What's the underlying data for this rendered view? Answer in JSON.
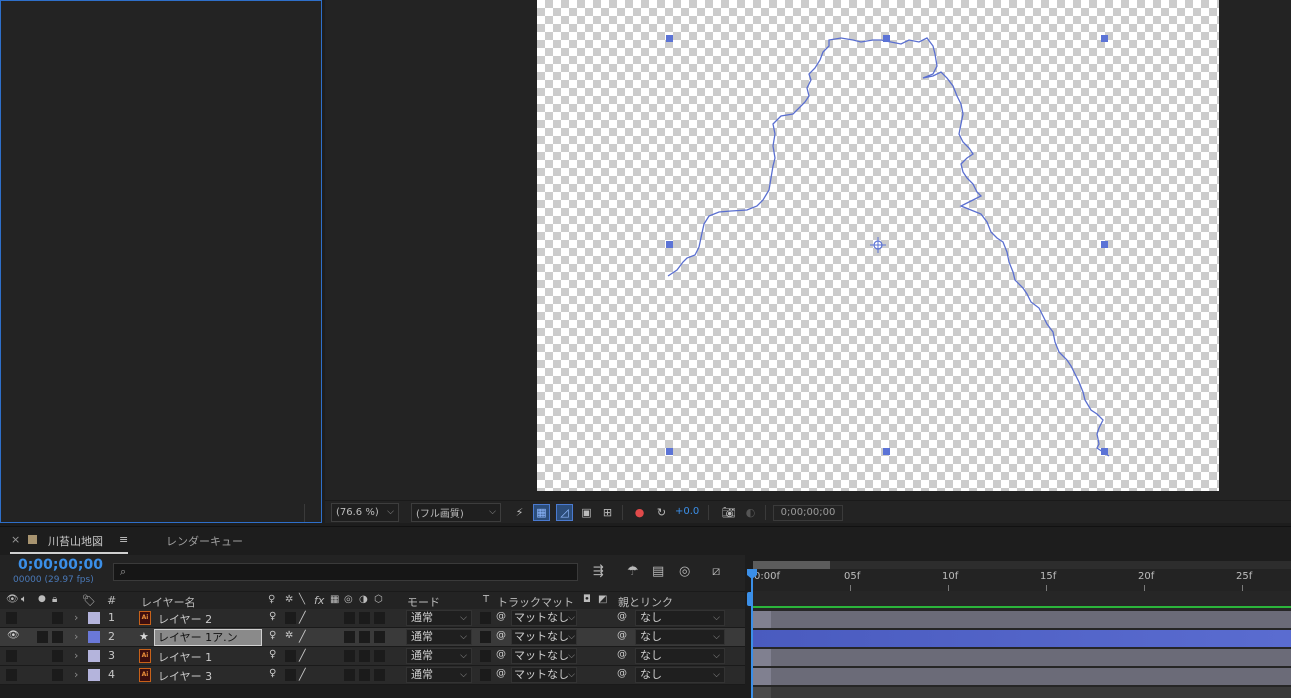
{
  "viewer": {
    "zoom": "(76.6 %)",
    "resolution": "(フル画質)",
    "exposure": "+0.0",
    "timecode": "0;00;00;00"
  },
  "timeline": {
    "tab_close": "×",
    "comp_tab": "川苔山地図",
    "comp_menu": "≡",
    "render_queue_tab": "レンダーキュー",
    "current_time": "0;00;00;00",
    "frame_info": "00000 (29.97 fps)",
    "search_placeholder": "",
    "columns": {
      "number": "#",
      "layer_name": "レイヤー名",
      "mode": "モード",
      "t": "T",
      "track_matte": "トラックマット",
      "parent": "親とリンク"
    },
    "ruler_labels": [
      "0:00f",
      "05f",
      "10f",
      "15f",
      "20f",
      "25f"
    ],
    "layers": [
      {
        "num": "1",
        "name": "レイヤー 2",
        "mode": "通常",
        "matte": "マットなし",
        "parent": "なし",
        "color": "#b4b4dc",
        "type": "ai",
        "visible": false,
        "selected": false
      },
      {
        "num": "2",
        "name": "レイヤー 1アウトライン",
        "mode": "通常",
        "matte": "マットなし",
        "parent": "なし",
        "color": "#6a78d8",
        "type": "shape",
        "visible": true,
        "selected": true
      },
      {
        "num": "3",
        "name": "レイヤー 1",
        "mode": "通常",
        "matte": "マットなし",
        "parent": "なし",
        "color": "#b4b4dc",
        "type": "ai",
        "visible": false,
        "selected": false
      },
      {
        "num": "4",
        "name": "レイヤー 3",
        "mode": "通常",
        "matte": "マットなし",
        "parent": "なし",
        "color": "#b4b4dc",
        "type": "ai",
        "visible": false,
        "selected": false
      }
    ],
    "editing_name": "レイヤー 1ア.ン"
  },
  "colors": {
    "accent": "#3b8fe8",
    "path_stroke": "#5a6fd0",
    "handle": "#5b73d6",
    "selected_track": "#4a5bbf",
    "track": "#6b6b78",
    "work_line": "#2bb53b"
  },
  "icons": [
    "eye-icon",
    "audio-icon",
    "solo-icon",
    "lock-icon",
    "label-icon",
    "search-icon",
    "star-icon",
    "ai-file-icon",
    "pickwhip-icon",
    "graph-editor-icon",
    "motion-blur-icon",
    "camera-icon"
  ]
}
